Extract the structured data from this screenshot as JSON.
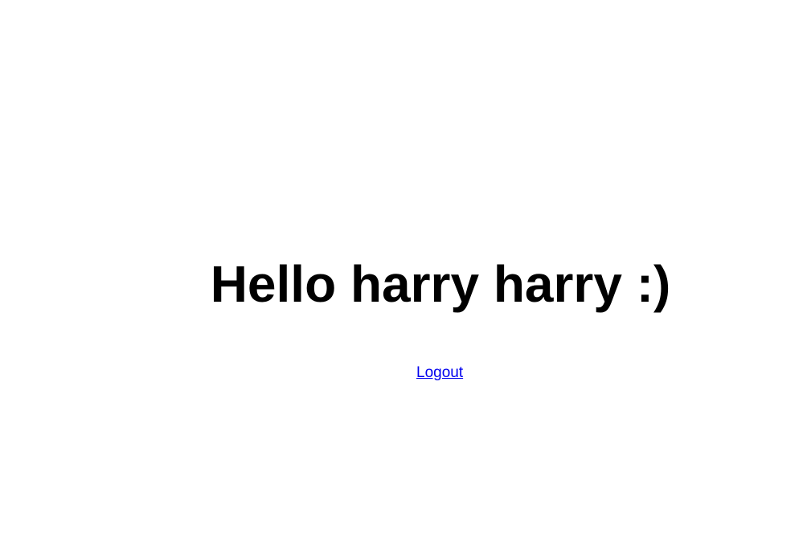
{
  "greeting": {
    "text": "Hello harry harry :)"
  },
  "logout": {
    "label": "Logout"
  },
  "colors": {
    "background": "#ffffff",
    "text": "#000000",
    "link": "#0000ee"
  }
}
